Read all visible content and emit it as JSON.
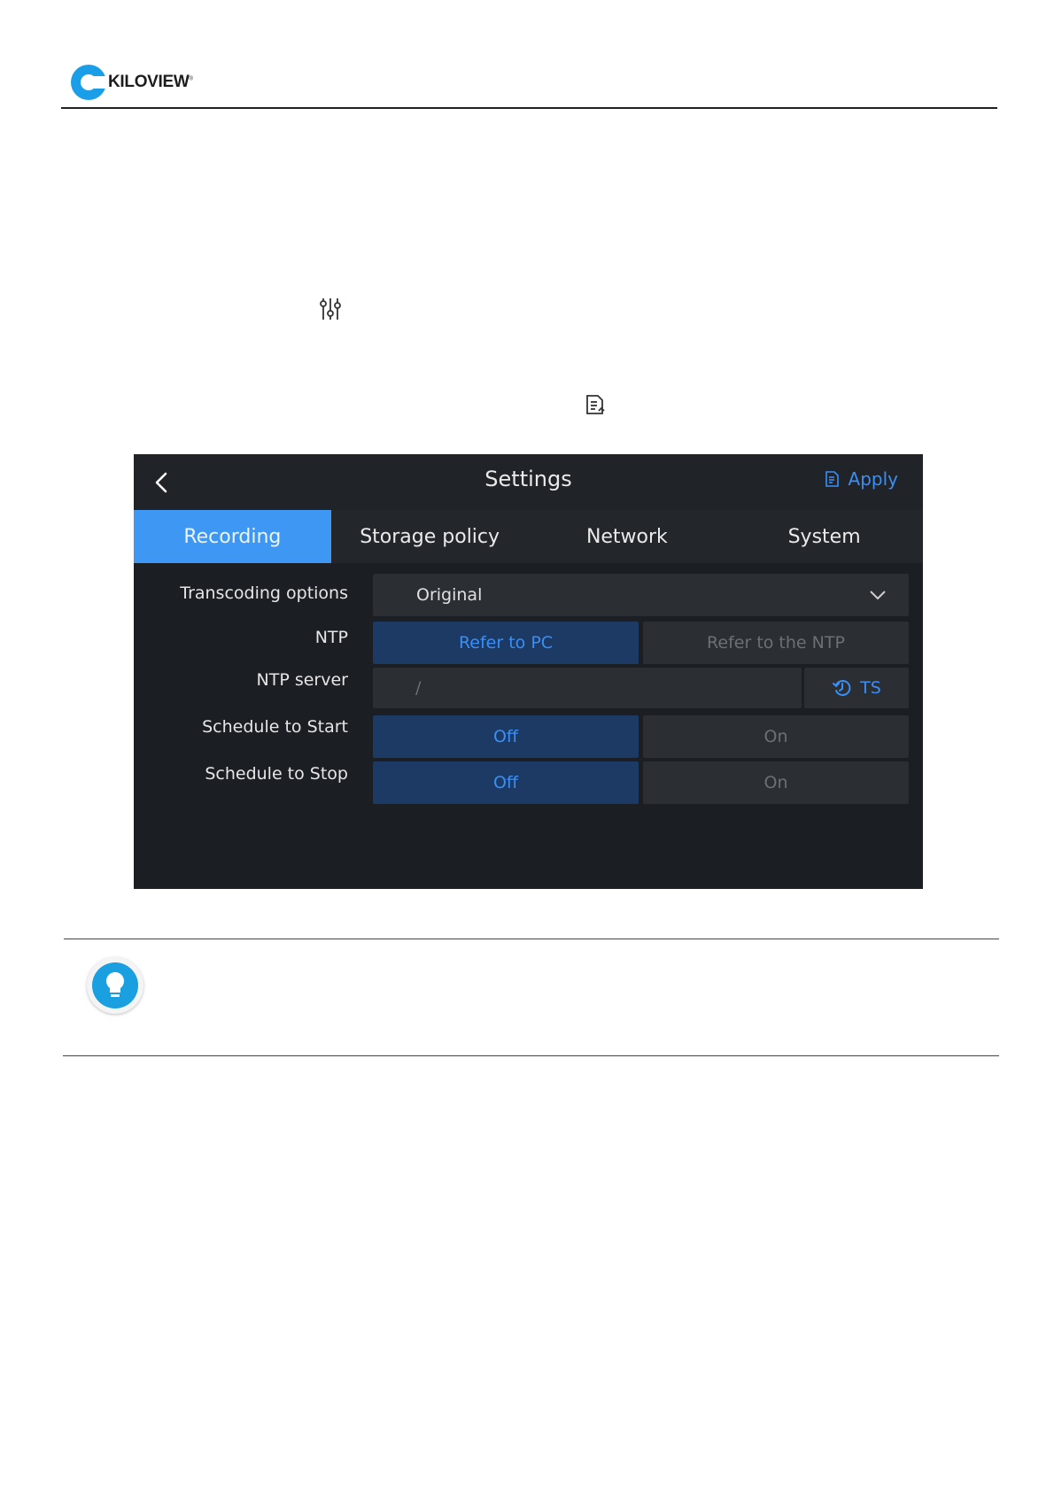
{
  "header": {
    "brand": "KILOVIEW"
  },
  "colors": {
    "accent_blue": "#3a8ff7",
    "active_tab": "#3e97f2",
    "screen_bg": "#1b1e23",
    "brand_blue": "#1b9ee8"
  },
  "icons": {
    "inline_1": "sliders-icon",
    "inline_2": "apply-doc-icon",
    "tip": "lightbulb-icon"
  },
  "screen": {
    "title": "Settings",
    "apply_label": "Apply",
    "tabs": [
      {
        "label": "Recording",
        "active": true
      },
      {
        "label": "Storage policy",
        "active": false
      },
      {
        "label": "Network",
        "active": false
      },
      {
        "label": "System",
        "active": false
      }
    ],
    "rows": {
      "transcoding": {
        "label": "Transcoding options",
        "value": "Original"
      },
      "ntp": {
        "label": "NTP",
        "option_a": "Refer to PC",
        "option_b": "Refer to the NTP",
        "selected": "Refer to PC"
      },
      "ntp_server": {
        "label": "NTP server",
        "value": "/",
        "button": "TS"
      },
      "schedule_start": {
        "label": "Schedule to Start",
        "off": "Off",
        "on": "On",
        "selected": "Off"
      },
      "schedule_stop": {
        "label": "Schedule to Stop",
        "off": "Off",
        "on": "On",
        "selected": "Off"
      }
    }
  }
}
